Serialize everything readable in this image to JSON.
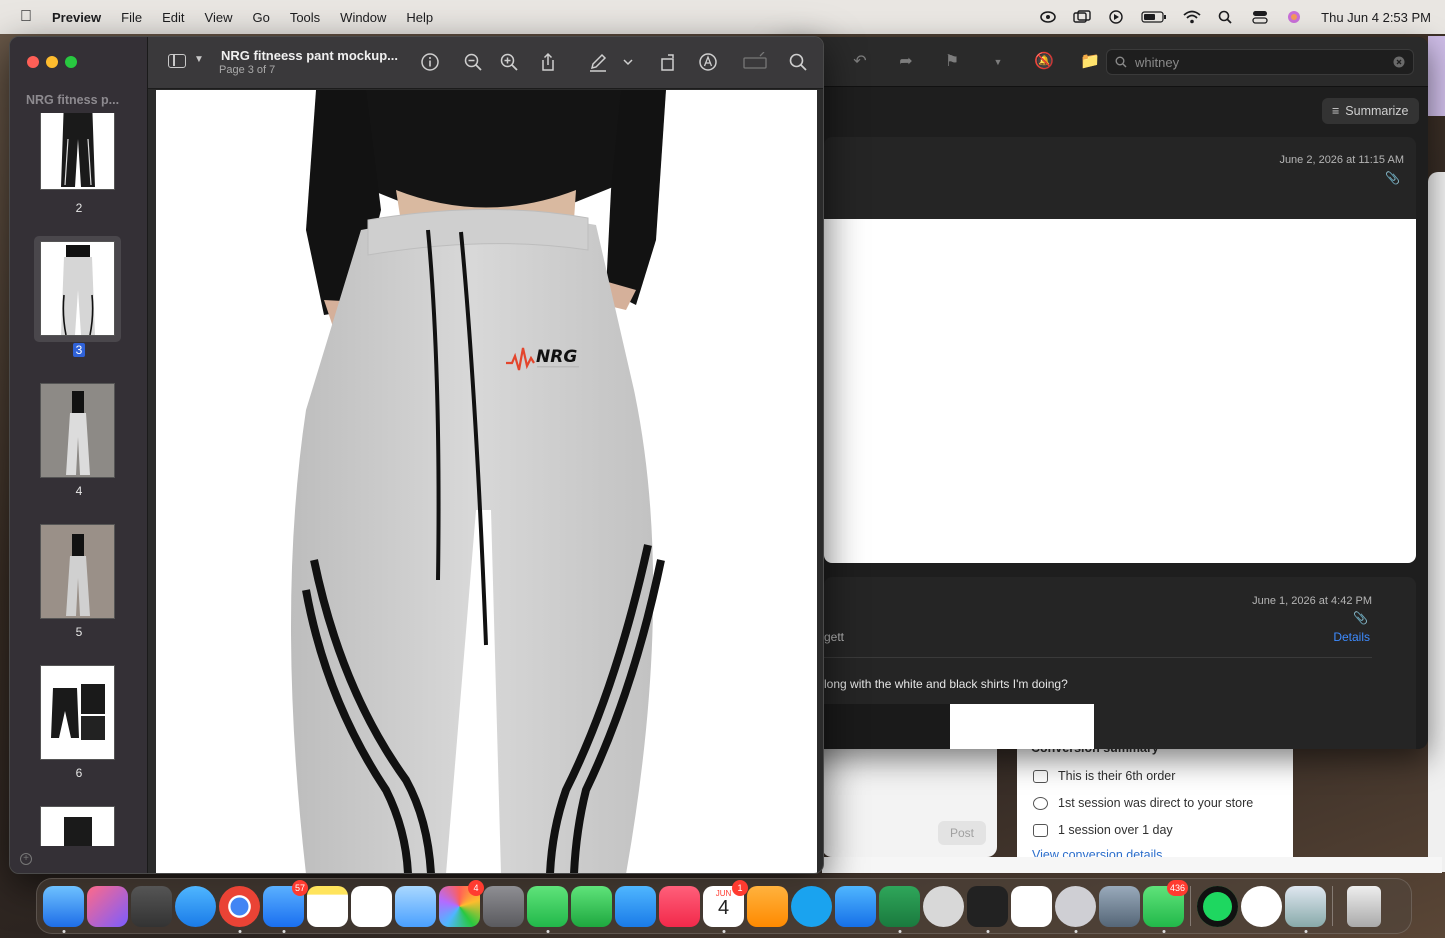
{
  "menubar": {
    "app": "Preview",
    "items": [
      "File",
      "Edit",
      "View",
      "Go",
      "Tools",
      "Window",
      "Help"
    ],
    "clock": "Thu Jun 4  2:53 PM"
  },
  "preview": {
    "sidebar_title": "NRG fitness p...",
    "doc_title": "NRG fitneess pant mockup...",
    "doc_subtitle": "Page 3 of 7",
    "thumbnails": [
      {
        "label": "2"
      },
      {
        "label": "3"
      },
      {
        "label": "4"
      },
      {
        "label": "5"
      },
      {
        "label": "6"
      }
    ],
    "logo_text": "NRG"
  },
  "mail": {
    "search_value": "whitney",
    "summarize_label": "Summarize",
    "msg1_date": "June 2, 2026 at 11:15 AM",
    "msg2_date": "June 1, 2026 at 4:42 PM",
    "msg2_sender_fragment": "gett",
    "msg2_details": "Details",
    "msg2_body": "long with the white and black shirts I'm doing?"
  },
  "shop": {
    "post_label": "Post",
    "summary_title": "Conversion summary",
    "rows": [
      "This is their 6th order",
      "1st session was direct to your store",
      "1 session over 1 day"
    ],
    "link": "View conversion details"
  },
  "dock": {
    "badges": {
      "mail": "57",
      "photos": "4",
      "calendar": "1",
      "messages": "436"
    },
    "calendar_month": "JUN",
    "calendar_day": "4"
  },
  "colors": {
    "accent_blue": "#3d8bff",
    "badge_red": "#ff3b30",
    "selection_blue": "#2f62d8"
  }
}
